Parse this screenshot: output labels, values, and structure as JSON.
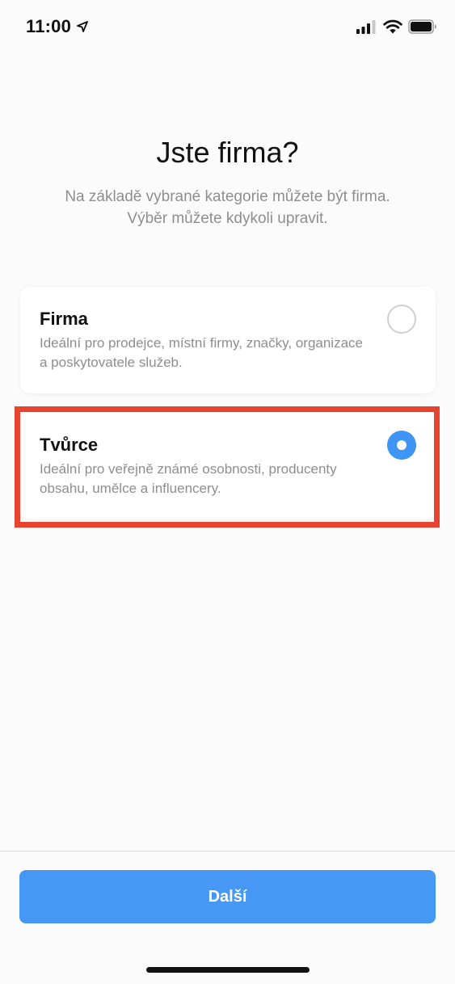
{
  "status_bar": {
    "time": "11:00",
    "icons": [
      "location-arrow-icon",
      "cellular-signal-icon",
      "wifi-icon",
      "battery-icon"
    ]
  },
  "header": {
    "title": "Jste firma?",
    "subtitle": "Na základě vybrané kategorie můžete být firma. Výběr můžete kdykoli upravit."
  },
  "options": [
    {
      "title": "Firma",
      "description": "Ideální pro prodejce, místní firmy, značky, organizace a poskytovatele služeb.",
      "selected": false
    },
    {
      "title": "Tvůrce",
      "description": "Ideální pro veřejně známé osobnosti, producenty obsahu, umělce a influencery.",
      "selected": true
    }
  ],
  "footer": {
    "next_label": "Další"
  },
  "colors": {
    "accent": "#4797f4",
    "highlight": "#e8432e",
    "secondary_text": "#8e8e8e"
  }
}
